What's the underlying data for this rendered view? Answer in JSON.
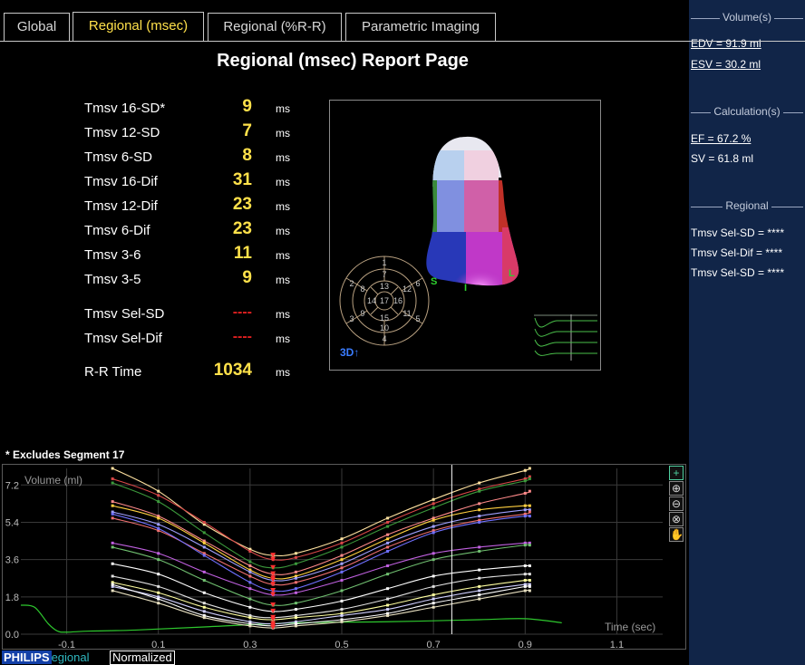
{
  "tabs": [
    {
      "label": "Global"
    },
    {
      "label": "Regional (msec)"
    },
    {
      "label": "Regional (%R-R)"
    },
    {
      "label": "Parametric Imaging"
    }
  ],
  "report_title": "Regional (msec) Report Page",
  "metrics": [
    {
      "label": "Tmsv 16-SD*",
      "value": "9",
      "unit": "ms"
    },
    {
      "label": "Tmsv 12-SD",
      "value": "7",
      "unit": "ms"
    },
    {
      "label": "Tmsv 6-SD",
      "value": "8",
      "unit": "ms"
    },
    {
      "label": "Tmsv 16-Dif",
      "value": "31",
      "unit": "ms"
    },
    {
      "label": "Tmsv 12-Dif",
      "value": "23",
      "unit": "ms"
    },
    {
      "label": "Tmsv 6-Dif",
      "value": "23",
      "unit": "ms"
    },
    {
      "label": "Tmsv 3-6",
      "value": "11",
      "unit": "ms"
    },
    {
      "label": "Tmsv 3-5",
      "value": "9",
      "unit": "ms"
    },
    {
      "label": "Tmsv Sel-SD",
      "value": "----",
      "unit": "ms"
    },
    {
      "label": "Tmsv Sel-Dif",
      "value": "----",
      "unit": "ms"
    },
    {
      "label": "R-R Time",
      "value": "1034",
      "unit": "ms"
    }
  ],
  "viewport": {
    "bullseye_segments": [
      "1",
      "2",
      "3",
      "4",
      "5",
      "6",
      "7",
      "8",
      "9",
      "10",
      "11",
      "12",
      "13",
      "14",
      "15",
      "16",
      "17"
    ],
    "view_labels": {
      "septal": "S",
      "inferior": "I",
      "lateral": "L"
    },
    "view_badge": "3D↑"
  },
  "footnote": "* Excludes Segment 17",
  "brand": {
    "philips": "PHILIPS",
    "regional": "egional"
  },
  "normalized_label": "Normalized",
  "tools": [
    {
      "icon": "add-icon",
      "glyph": "+"
    },
    {
      "icon": "zoom-in-icon",
      "glyph": "⊕"
    },
    {
      "icon": "zoom-out-icon",
      "glyph": "⊖"
    },
    {
      "icon": "zoom-reset-icon",
      "glyph": "⊗"
    },
    {
      "icon": "pan-hand-icon",
      "glyph": "✋"
    }
  ],
  "side": {
    "volume_header": "Volume(s)",
    "edv": "EDV = 91.9 ml",
    "esv": "ESV = 30.2 ml",
    "calc_header": "Calculation(s)",
    "ef": "EF = 67.2 %",
    "sv": "SV = 61.8 ml",
    "regional_header": "Regional",
    "regional_items": [
      "Tmsv Sel-SD = ****",
      "Tmsv Sel-Dif = ****",
      "Tmsv Sel-SD = ****"
    ]
  },
  "chart_data": {
    "type": "line",
    "ylabel": "Volume (ml)",
    "xlabel": "Time (sec)",
    "xlim": [
      -0.2,
      1.2
    ],
    "ylim": [
      0.0,
      8.0
    ],
    "xticks": [
      -0.1,
      0.1,
      0.3,
      0.5,
      0.7,
      0.9,
      1.1
    ],
    "yticks": [
      0.0,
      1.8,
      3.6,
      5.4,
      7.2
    ],
    "cursor_x": 0.74,
    "x": [
      0.0,
      0.1,
      0.2,
      0.3,
      0.35,
      0.4,
      0.5,
      0.6,
      0.7,
      0.8,
      0.9,
      0.91
    ],
    "series": [
      {
        "color": "#ffe2a0",
        "values": [
          8.0,
          6.9,
          5.3,
          4.1,
          3.8,
          3.9,
          4.6,
          5.6,
          6.5,
          7.3,
          7.9,
          8.0
        ]
      },
      {
        "color": "#d84848",
        "values": [
          7.5,
          6.7,
          5.4,
          4.0,
          3.6,
          3.7,
          4.4,
          5.4,
          6.3,
          7.0,
          7.5,
          7.6
        ]
      },
      {
        "color": "#3c9a3c",
        "values": [
          7.3,
          6.4,
          4.9,
          3.5,
          3.2,
          3.4,
          4.2,
          5.2,
          6.1,
          6.9,
          7.4,
          7.5
        ]
      },
      {
        "color": "#ff8a8a",
        "values": [
          6.4,
          5.7,
          4.5,
          3.3,
          2.9,
          3.0,
          3.8,
          4.8,
          5.6,
          6.3,
          6.8,
          6.9
        ]
      },
      {
        "color": "#ffd040",
        "values": [
          6.2,
          5.6,
          4.4,
          3.1,
          2.7,
          2.8,
          3.6,
          4.6,
          5.5,
          6.0,
          6.2,
          6.2
        ]
      },
      {
        "color": "#a0a0ff",
        "values": [
          5.9,
          5.3,
          4.2,
          3.0,
          2.6,
          2.7,
          3.4,
          4.4,
          5.2,
          5.7,
          6.0,
          6.0
        ]
      },
      {
        "color": "#f07070",
        "values": [
          5.6,
          5.0,
          3.9,
          2.8,
          2.4,
          2.5,
          3.2,
          4.2,
          5.0,
          5.5,
          5.8,
          5.9
        ]
      },
      {
        "color": "#7070ff",
        "values": [
          5.8,
          5.1,
          3.8,
          2.5,
          2.1,
          2.2,
          3.0,
          4.0,
          4.9,
          5.4,
          5.7,
          5.7
        ]
      },
      {
        "color": "#c060e0",
        "values": [
          4.4,
          3.9,
          3.0,
          2.2,
          1.9,
          2.0,
          2.6,
          3.3,
          3.9,
          4.2,
          4.4,
          4.4
        ]
      },
      {
        "color": "#70c070",
        "values": [
          4.2,
          3.6,
          2.6,
          1.7,
          1.4,
          1.5,
          2.1,
          2.9,
          3.6,
          4.0,
          4.3,
          4.3
        ]
      },
      {
        "color": "#ffffff",
        "values": [
          3.4,
          2.9,
          2.0,
          1.3,
          1.1,
          1.2,
          1.6,
          2.2,
          2.8,
          3.1,
          3.3,
          3.3
        ]
      },
      {
        "color": "#e0e0e0",
        "values": [
          2.8,
          2.3,
          1.5,
          0.9,
          0.8,
          0.9,
          1.2,
          1.7,
          2.3,
          2.7,
          2.9,
          2.9
        ]
      },
      {
        "color": "#ffffa0",
        "values": [
          2.5,
          2.0,
          1.3,
          0.8,
          0.7,
          0.8,
          1.0,
          1.4,
          1.9,
          2.3,
          2.6,
          2.6
        ]
      },
      {
        "color": "#d0d0ff",
        "values": [
          2.3,
          1.8,
          1.1,
          0.6,
          0.5,
          0.6,
          0.9,
          1.2,
          1.7,
          2.1,
          2.4,
          2.4
        ]
      },
      {
        "color": "#ffffff",
        "values": [
          2.4,
          1.7,
          0.9,
          0.5,
          0.4,
          0.5,
          0.7,
          1.0,
          1.5,
          1.9,
          2.3,
          2.3
        ]
      },
      {
        "color": "#e8e0c0",
        "values": [
          2.1,
          1.5,
          0.8,
          0.4,
          0.3,
          0.4,
          0.6,
          0.9,
          1.3,
          1.7,
          2.1,
          2.1
        ]
      }
    ],
    "trigger_series": {
      "color": "#2ec82e",
      "x": [
        -0.2,
        -0.17,
        -0.14,
        -0.12,
        -0.1,
        -0.05,
        0.05,
        0.2,
        0.4,
        0.6,
        0.8,
        0.9,
        0.98
      ],
      "values": [
        1.4,
        1.3,
        0.5,
        0.15,
        0.1,
        0.15,
        0.2,
        0.35,
        0.55,
        0.6,
        0.7,
        0.75,
        0.55
      ]
    },
    "min_marker_color": "#ff3030"
  }
}
